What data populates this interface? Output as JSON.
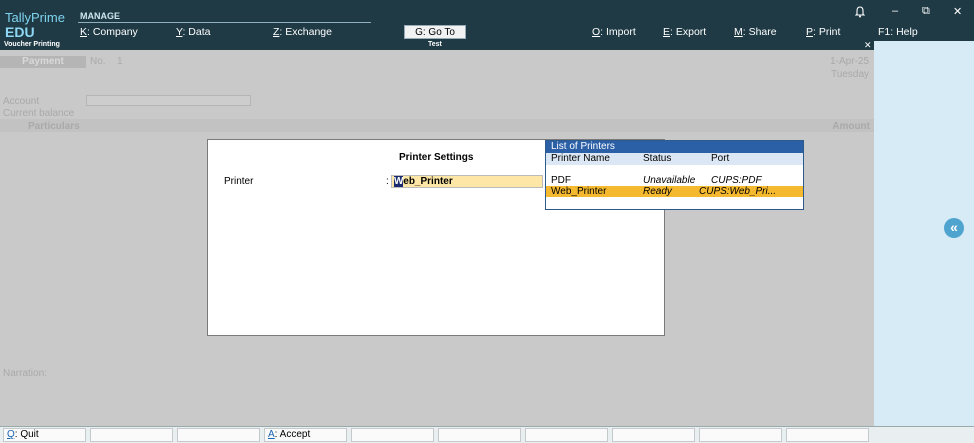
{
  "brand": {
    "name": "TallyPrime",
    "edition": "EDU"
  },
  "top_menu": {
    "section_label": "MANAGE",
    "items": [
      {
        "key": "K",
        "label": ": Company"
      },
      {
        "key": "Y",
        "label": ": Data"
      },
      {
        "key": "Z",
        "label": ": Exchange"
      }
    ],
    "goto": "G: Go To",
    "right_items": [
      {
        "key": "O",
        "label": ": Import"
      },
      {
        "key": "E",
        "label": ": Export"
      },
      {
        "key": "M",
        "label": ": Share"
      },
      {
        "key": "P",
        "label": ": Print"
      },
      {
        "key": "F1",
        "label": ": Help"
      }
    ]
  },
  "window_controls": {
    "minimize": "–",
    "restore": "⧉",
    "close": "✕"
  },
  "title_strip": {
    "left": "Voucher Printing",
    "center": "Test",
    "close": "✕"
  },
  "voucher": {
    "type": "Payment",
    "no_label": "No.",
    "no_value": "1",
    "date": "1-Apr-25",
    "day": "Tuesday",
    "account_label": "Account",
    "balance_label": "Current balance",
    "col_particulars": "Particulars",
    "col_amount": "Amount",
    "narration_label": "Narration:"
  },
  "dialog": {
    "title": "Printer Settings",
    "printer_label": "Printer",
    "colon": ":",
    "printer_value_first": "W",
    "printer_value_rest": "eb_Printer"
  },
  "printer_list": {
    "title": "List of Printers",
    "headers": [
      "Printer Name",
      "Status",
      "Port"
    ],
    "rows": [
      {
        "name": "PDF",
        "status": "Unavailable",
        "port": "CUPS:PDF"
      },
      {
        "name": "Web_Printer",
        "status": "Ready",
        "port": "CUPS:Web_Pri..."
      }
    ]
  },
  "bottom_buttons": [
    {
      "key": "Q",
      "label": ": Quit"
    },
    {
      "key": "A",
      "label": ": Accept"
    }
  ],
  "collapse_icon": "«"
}
